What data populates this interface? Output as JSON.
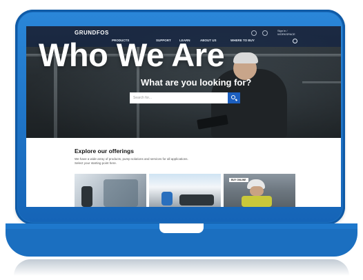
{
  "brand": {
    "logo_text": "GRUNDFOS"
  },
  "nav": {
    "items": [
      "PRODUCTS",
      "SUPPORT",
      "LEARN",
      "ABOUT US",
      "WHERE TO BUY"
    ],
    "util_text": "Sign in / WORKSPACE"
  },
  "hero": {
    "title": "Who We Are",
    "search_prompt": "What are you looking for?",
    "search_placeholder": "Search for..."
  },
  "offerings": {
    "title": "Explore our offerings",
    "description": "We have a wide array of products, pump solutions and services for all applications. Select your starting point here.",
    "cards": [
      {
        "badge": ""
      },
      {
        "badge": ""
      },
      {
        "badge": "BUY ONLINE"
      }
    ]
  },
  "colors": {
    "frame_blue": "#1b6fc0",
    "search_button": "#1c5fbf"
  }
}
